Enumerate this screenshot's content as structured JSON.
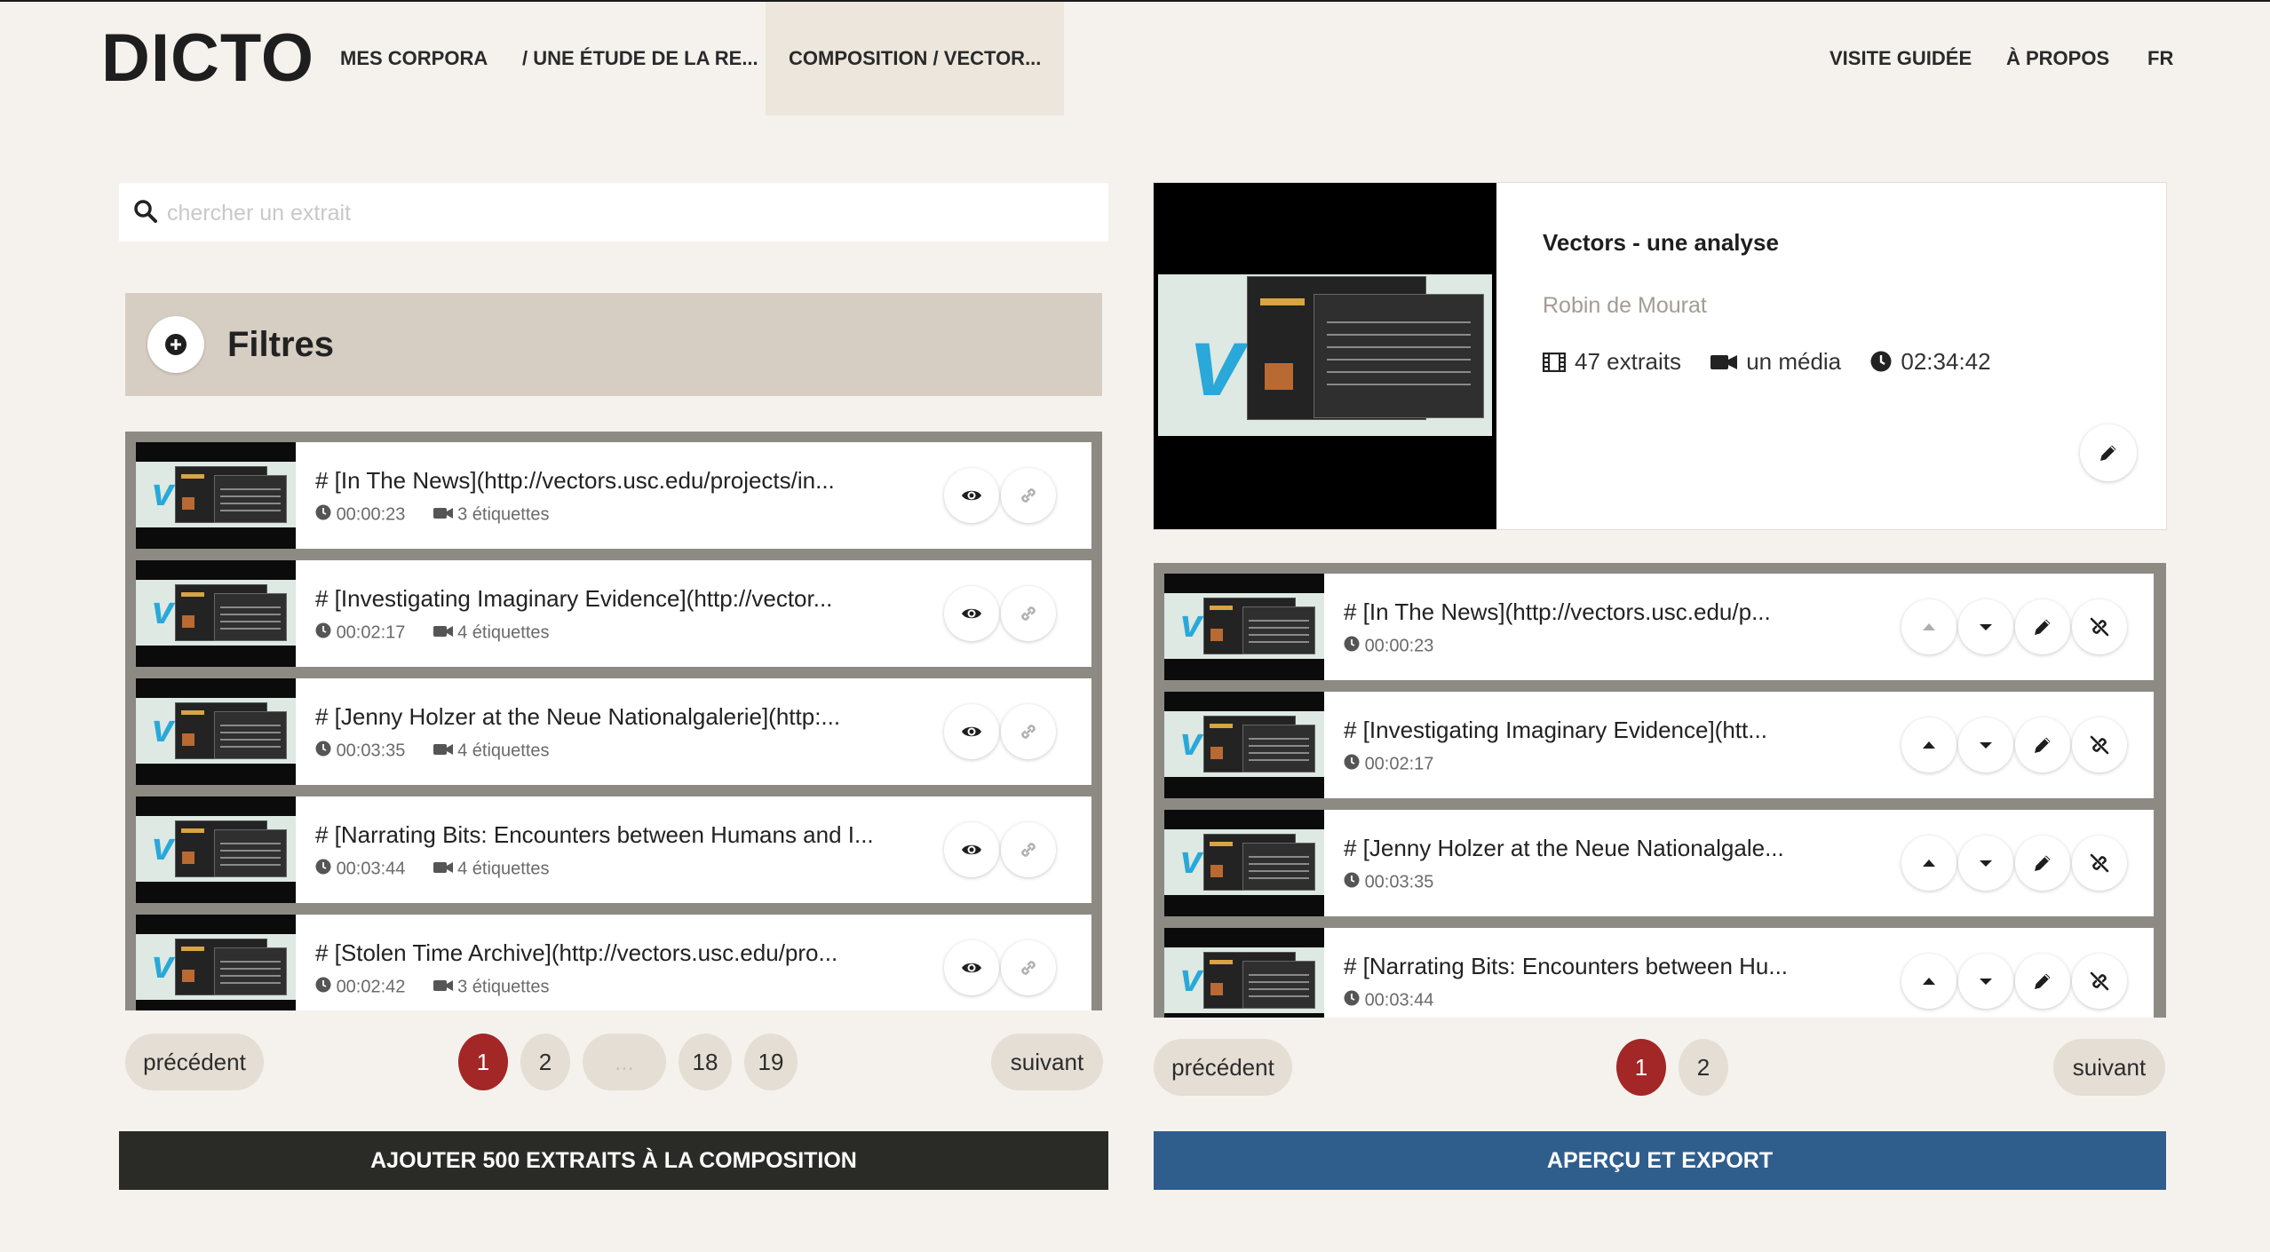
{
  "app": {
    "logo": "DICTO"
  },
  "nav": {
    "corpora": "MES CORPORA",
    "corpus": "/ UNE ÉTUDE DE LA RE...",
    "composition": "COMPOSITION / VECTOR...",
    "tour": "VISITE GUIDÉE",
    "about": "À PROPOS",
    "lang": "FR"
  },
  "search": {
    "placeholder": "chercher un extrait",
    "value": ""
  },
  "filters": {
    "label": "Filtres"
  },
  "excerpts": [
    {
      "title": "# [In The News](http://vectors.usc.edu/projects/in...",
      "duration": "00:00:23",
      "tags": "3 étiquettes"
    },
    {
      "title": "# [Investigating Imaginary Evidence](http://vector...",
      "duration": "00:02:17",
      "tags": "4 étiquettes"
    },
    {
      "title": "# [Jenny Holzer at the Neue Nationalgalerie](http:...",
      "duration": "00:03:35",
      "tags": "4 étiquettes"
    },
    {
      "title": "# [Narrating Bits: Encounters between Humans and I...",
      "duration": "00:03:44",
      "tags": "4 étiquettes"
    },
    {
      "title": "# [Stolen Time Archive](http://vectors.usc.edu/pro...",
      "duration": "00:02:42",
      "tags": "3 étiquettes"
    }
  ],
  "left_pagination": {
    "prev": "précédent",
    "next": "suivant",
    "pages": [
      "1",
      "2",
      "...",
      "18",
      "19"
    ],
    "active": "1"
  },
  "add_button": "AJOUTER 500 EXTRAITS À LA COMPOSITION",
  "composition": {
    "title": "Vectors - une analyse",
    "author": "Robin de Mourat",
    "excerpts_count": "47 extraits",
    "media_count": "un média",
    "duration": "02:34:42"
  },
  "composition_items": [
    {
      "title": "# [In The News](http://vectors.usc.edu/p...",
      "duration": "00:00:23"
    },
    {
      "title": "# [Investigating Imaginary Evidence](htt...",
      "duration": "00:02:17"
    },
    {
      "title": "# [Jenny Holzer at the Neue Nationalgale...",
      "duration": "00:03:35"
    },
    {
      "title": "# [Narrating Bits: Encounters between Hu...",
      "duration": "00:03:44"
    }
  ],
  "right_pagination": {
    "prev": "précédent",
    "next": "suivant",
    "pages": [
      "1",
      "2"
    ],
    "active": "1"
  },
  "export_button": "APERÇU ET EXPORT",
  "colors": {
    "active_page": "#a32727",
    "export": "#2f5e8d",
    "add": "#2a2a26",
    "filters_bg": "#d6cec2"
  },
  "icons": [
    "search-icon",
    "plus-circle-icon",
    "eye-icon",
    "link-icon",
    "clock-icon",
    "video-camera-icon",
    "film-icon",
    "pencil-icon",
    "arrow-up-icon",
    "arrow-down-icon",
    "unlink-icon"
  ]
}
